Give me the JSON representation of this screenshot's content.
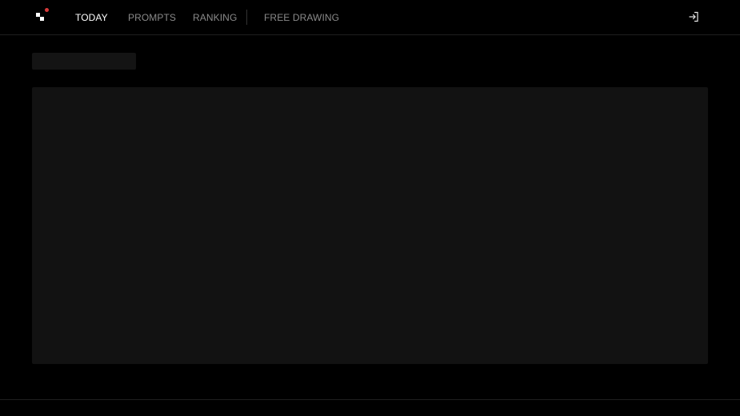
{
  "nav": {
    "items": [
      {
        "label": "TODAY",
        "active": true
      },
      {
        "label": "PROMPTS",
        "active": false
      },
      {
        "label": "RANKING",
        "active": false
      },
      {
        "label": "FREE DRAWING",
        "active": false
      }
    ]
  },
  "header": {
    "logo_icon": "pixel-logo-icon",
    "login_icon": "sign-in-icon"
  },
  "footer": {
    "text": ""
  },
  "colors": {
    "background": "#000000",
    "active_nav": "#ffffff",
    "inactive_nav": "#8a8a8a",
    "logo_dot": "#d83a3a",
    "skeleton": "#121212"
  }
}
